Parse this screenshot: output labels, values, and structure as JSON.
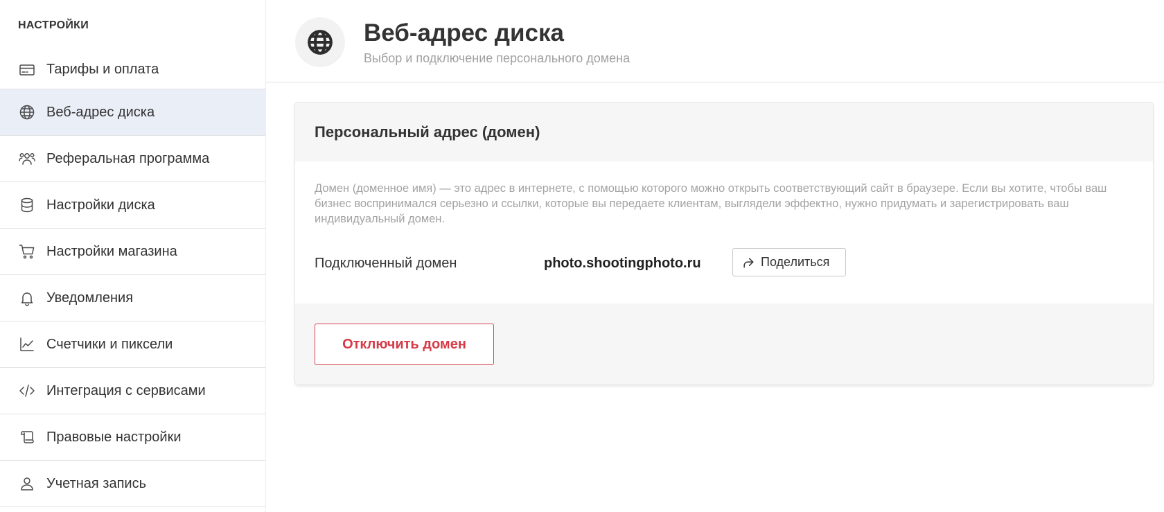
{
  "sidebar": {
    "heading": "НАСТРОЙКИ",
    "items": [
      {
        "label": "Тарифы и оплата",
        "icon": "credit-card-icon"
      },
      {
        "label": "Веб-адрес диска",
        "icon": "globe-icon",
        "active": true
      },
      {
        "label": "Реферальная программа",
        "icon": "users-icon"
      },
      {
        "label": "Настройки диска",
        "icon": "database-icon"
      },
      {
        "label": "Настройки магазина",
        "icon": "cart-icon"
      },
      {
        "label": "Уведомления",
        "icon": "bell-icon"
      },
      {
        "label": "Счетчики и пиксели",
        "icon": "chart-icon"
      },
      {
        "label": "Интеграция с сервисами",
        "icon": "code-icon"
      },
      {
        "label": "Правовые настройки",
        "icon": "scroll-icon"
      },
      {
        "label": "Учетная запись",
        "icon": "user-icon"
      }
    ]
  },
  "header": {
    "icon": "globe-icon",
    "title": "Веб-адрес диска",
    "subtitle": "Выбор и подключение персонального домена"
  },
  "card": {
    "title": "Персональный адрес (домен)",
    "description": "Домен (доменное имя) — это адрес в интернете, с помощью которого можно открыть соответствующий сайт в браузере. Если вы хотите, чтобы ваш бизнес воспринимался серьезно и ссылки, которые вы передаете клиентам, выглядели эффектно, нужно придумать и зарегистрировать ваш индивидуальный домен.",
    "domain_label": "Подключенный домен",
    "domain_value": "photo.shootingphoto.ru",
    "share_label": "Поделиться",
    "disconnect_label": "Отключить домен"
  },
  "colors": {
    "active_item_bg": "#e9eef7",
    "danger": "#d63a47"
  }
}
